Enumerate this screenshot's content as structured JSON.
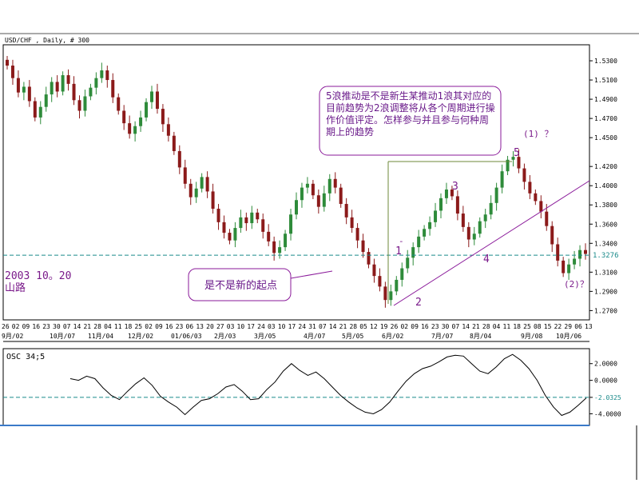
{
  "chart_data": [
    {
      "type": "candlestick",
      "title": "USD/CHF , Daily, # 300",
      "y_ticks": [
        "1.5300",
        "1.5100",
        "1.4900",
        "1.4700",
        "1.4500",
        "1.4200",
        "1.4000",
        "1.3800",
        "1.3600",
        "1.3400",
        "1.3100",
        "1.2900",
        "1.2700"
      ],
      "y_tick_values": [
        1.53,
        1.51,
        1.49,
        1.47,
        1.45,
        1.42,
        1.4,
        1.38,
        1.36,
        1.34,
        1.31,
        1.29,
        1.27
      ],
      "current_price_label": "1.3276",
      "current_price": 1.3276,
      "x_day_labels": [
        "26",
        "02",
        "09",
        "16",
        "23",
        "30",
        "07",
        "14",
        "21",
        "28",
        "04",
        "11",
        "18",
        "25",
        "02",
        "09",
        "16",
        "23",
        "06",
        "13",
        "20",
        "27",
        "03",
        "10",
        "17",
        "24",
        "03",
        "10",
        "17",
        "24",
        "31",
        "07",
        "14",
        "21",
        "28",
        "05",
        "12",
        "19",
        "26",
        "02",
        "09",
        "16",
        "23",
        "30",
        "07",
        "14",
        "21",
        "28",
        "04",
        "11",
        "18",
        "25",
        "08",
        "15",
        "22",
        "29",
        "06",
        "13"
      ],
      "x_month_labels": [
        "9月/02",
        "10月/07",
        "11月/04",
        "12月/02",
        "01/06/03",
        "2月/03",
        "3月/05",
        "4月/07",
        "5月/05",
        "6月/02",
        "7月/07",
        "8月/04",
        "9月/08",
        "10月/06"
      ],
      "close_series": [
        1.525,
        1.512,
        1.497,
        1.503,
        1.488,
        1.471,
        1.482,
        1.495,
        1.508,
        1.498,
        1.515,
        1.506,
        1.489,
        1.478,
        1.493,
        1.502,
        1.512,
        1.52,
        1.51,
        1.492,
        1.478,
        1.465,
        1.454,
        1.462,
        1.471,
        1.487,
        1.498,
        1.48,
        1.464,
        1.452,
        1.436,
        1.419,
        1.402,
        1.388,
        1.397,
        1.409,
        1.394,
        1.376,
        1.362,
        1.351,
        1.343,
        1.356,
        1.367,
        1.361,
        1.372,
        1.365,
        1.352,
        1.342,
        1.33,
        1.336,
        1.35,
        1.37,
        1.385,
        1.398,
        1.402,
        1.39,
        1.378,
        1.392,
        1.407,
        1.398,
        1.381,
        1.367,
        1.356,
        1.343,
        1.331,
        1.318,
        1.306,
        1.295,
        1.281,
        1.29,
        1.302,
        1.314,
        1.325,
        1.336,
        1.347,
        1.355,
        1.362,
        1.374,
        1.387,
        1.396,
        1.389,
        1.371,
        1.357,
        1.344,
        1.35,
        1.363,
        1.37,
        1.382,
        1.398,
        1.415,
        1.427,
        1.43,
        1.418,
        1.404,
        1.392,
        1.384,
        1.373,
        1.358,
        1.339,
        1.322,
        1.309,
        1.318,
        1.324,
        1.333,
        1.329
      ],
      "wave_labels": [
        "1",
        "2",
        "3",
        "4",
        "5",
        "(1) ？",
        "(2)？",
        "-"
      ],
      "text_left": [
        "2003 10。20",
        "山路"
      ],
      "annotation_top": "5浪推动是不是新生某推动1浪其对应的目前趋势为2浪调整将从各个周期进行操作价值评定。怎样参与并且参与何种周期上的趋势",
      "annotation_bottom": "是不是新的起点"
    },
    {
      "type": "line",
      "title": "OSC 34;5",
      "y_ticks": [
        "2.0000",
        "0.0000",
        "-2.0325",
        "-4.0000"
      ],
      "y_tick_values": [
        2.0,
        0.0,
        -2.0325,
        -4.0
      ],
      "current_value_label": "-2.0325",
      "values": [
        0.2,
        0.0,
        0.5,
        0.2,
        -0.9,
        -1.8,
        -2.3,
        -1.3,
        -0.4,
        0.3,
        -0.6,
        -1.9,
        -2.6,
        -3.2,
        -4.1,
        -3.2,
        -2.4,
        -2.2,
        -1.6,
        -0.8,
        -0.5,
        -1.3,
        -2.3,
        -2.2,
        -1.1,
        -0.2,
        1.1,
        2.0,
        1.2,
        0.6,
        1.0,
        0.2,
        -0.8,
        -1.8,
        -2.6,
        -3.3,
        -3.8,
        -4.0,
        -3.5,
        -2.6,
        -1.3,
        -0.1,
        0.8,
        1.4,
        1.7,
        2.2,
        2.8,
        3.0,
        2.9,
        2.0,
        1.1,
        0.8,
        1.6,
        2.6,
        3.1,
        2.4,
        1.4,
        0.0,
        -1.8,
        -3.2,
        -4.2,
        -3.8,
        -3.0,
        -2.1
      ]
    }
  ]
}
